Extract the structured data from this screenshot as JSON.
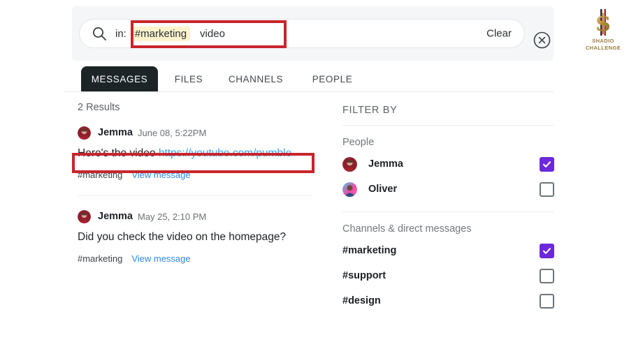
{
  "search": {
    "icon": "search-icon",
    "prefix": "in:",
    "chip": "#marketing",
    "term": "video",
    "clear_label": "Clear",
    "close_icon": "close-circle-icon"
  },
  "tabs": [
    {
      "label": "MESSAGES",
      "active": true
    },
    {
      "label": "FILES",
      "active": false
    },
    {
      "label": "CHANNELS",
      "active": false
    },
    {
      "label": "PEOPLE",
      "active": false
    }
  ],
  "results": {
    "count_label": "2 Results",
    "messages": [
      {
        "author": "Jemma",
        "time": "June 08, 5:22PM",
        "text_plain": "Here's the video ",
        "text_link": "https://youtube.com/pumble",
        "channel": "#marketing",
        "view_label": "View message"
      },
      {
        "author": "Jemma",
        "time": "May 25, 2:10 PM",
        "text_plain": "Did you check the video on the homepage?",
        "text_link": "",
        "channel": "#marketing",
        "view_label": "View message"
      }
    ]
  },
  "filters": {
    "title": "FILTER BY",
    "people_label": "People",
    "people": [
      {
        "name": "Jemma",
        "checked": true
      },
      {
        "name": "Oliver",
        "checked": false
      }
    ],
    "channels_label": "Channels & direct messages",
    "channels": [
      {
        "name": "#marketing",
        "checked": true
      },
      {
        "name": "#support",
        "checked": false
      },
      {
        "name": "#design",
        "checked": false
      }
    ]
  },
  "watermark": {
    "line1": "SHADIO",
    "line2": "CHALLENGE"
  },
  "colors": {
    "accent_purple": "#6d28d9",
    "link_blue": "#2e8ae6",
    "chip_yellow": "#fdf3cd",
    "tab_dark": "#1c2428",
    "annotation_red": "#c8252c"
  }
}
